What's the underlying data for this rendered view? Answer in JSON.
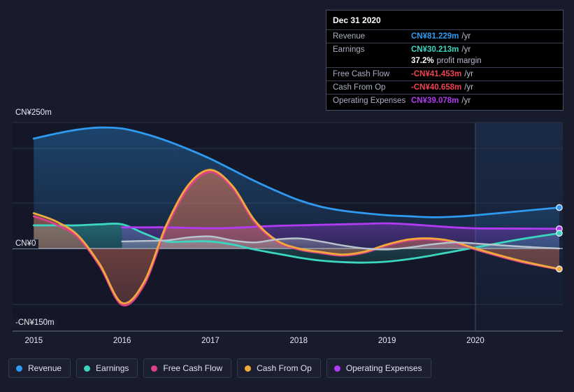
{
  "tooltip": {
    "date": "Dec 31 2020",
    "rows": [
      {
        "label": "Revenue",
        "value": "CN¥81.229m",
        "unit": "/yr",
        "color": "#2e9bf0"
      },
      {
        "label": "Earnings",
        "value": "CN¥30.213m",
        "unit": "/yr",
        "color": "#3ad6bf"
      },
      {
        "label": "",
        "value": "37.2%",
        "unit": "profit margin",
        "color": "#ffffff",
        "sub": true
      },
      {
        "label": "Free Cash Flow",
        "value": "-CN¥41.453m",
        "unit": "/yr",
        "color": "#ef4352"
      },
      {
        "label": "Cash From Op",
        "value": "-CN¥40.658m",
        "unit": "/yr",
        "color": "#ef4352"
      },
      {
        "label": "Operating Expenses",
        "value": "CN¥39.078m",
        "unit": "/yr",
        "color": "#b13bf2"
      }
    ]
  },
  "axis": {
    "y_top_label": "CN¥250m",
    "y_zero_label": "CN¥0",
    "y_bottom_label": "-CN¥150m",
    "x_labels": [
      "2015",
      "2016",
      "2017",
      "2018",
      "2019",
      "2020"
    ]
  },
  "legend": [
    {
      "label": "Revenue",
      "color": "#2e9bf0"
    },
    {
      "label": "Earnings",
      "color": "#3ad6bf"
    },
    {
      "label": "Free Cash Flow",
      "color": "#e0408a"
    },
    {
      "label": "Cash From Op",
      "color": "#f2a93b"
    },
    {
      "label": "Operating Expenses",
      "color": "#b13bf2"
    }
  ],
  "chart_data": {
    "type": "area",
    "title": "",
    "xlabel": "",
    "ylabel": "CN¥",
    "ylim": [
      -150,
      250
    ],
    "yticks": [
      250,
      0,
      -150
    ],
    "ytick_labels": [
      "CN¥250m",
      "CN¥0",
      "-CN¥150m"
    ],
    "xlim": [
      2014.76,
      2020.99
    ],
    "xticks": [
      2015,
      2016,
      2017,
      2018,
      2019,
      2020
    ],
    "grid": true,
    "legend_position": "bottom",
    "forecast_region_start": 2020.0,
    "units": "CN¥ millions per year",
    "series": [
      {
        "name": "Revenue",
        "color": "#2e9bf0",
        "x": [
          2015.0,
          2015.25,
          2015.5,
          2015.75,
          2016.0,
          2016.25,
          2016.5,
          2016.75,
          2017.0,
          2017.25,
          2017.5,
          2017.75,
          2018.0,
          2018.25,
          2018.5,
          2018.75,
          2019.0,
          2019.25,
          2019.5,
          2019.75,
          2020.0,
          2020.5,
          2020.95
        ],
        "values": [
          218,
          228,
          236,
          240,
          238,
          228,
          214,
          197,
          178,
          156,
          134,
          114,
          96,
          83,
          75,
          70,
          66,
          64,
          62,
          63,
          66,
          74,
          81.229
        ]
      },
      {
        "name": "Earnings",
        "color": "#3ad6bf",
        "x": [
          2015.0,
          2015.25,
          2015.5,
          2015.75,
          2016.0,
          2016.25,
          2016.5,
          2016.75,
          2017.0,
          2017.25,
          2017.5,
          2017.75,
          2018.0,
          2018.25,
          2018.5,
          2018.75,
          2019.0,
          2019.25,
          2019.5,
          2019.75,
          2020.0,
          2020.5,
          2020.95
        ],
        "values": [
          46,
          46,
          46,
          48,
          48,
          30,
          14,
          14,
          14,
          8,
          -2,
          -10,
          -18,
          -24,
          -27,
          -28,
          -26,
          -21,
          -14,
          -6,
          2,
          18,
          30.213
        ]
      },
      {
        "name": "Free Cash Flow",
        "color": "#e0408a",
        "x": [
          2015.0,
          2015.25,
          2015.5,
          2015.75,
          2016.0,
          2016.25,
          2016.5,
          2016.75,
          2017.0,
          2017.25,
          2017.5,
          2017.75,
          2018.0,
          2018.25,
          2018.5,
          2018.75,
          2019.0,
          2019.25,
          2019.5,
          2019.75,
          2020.0,
          2020.5,
          2020.95
        ],
        "values": [
          64,
          48,
          22,
          -36,
          -112,
          -72,
          40,
          120,
          152,
          120,
          52,
          14,
          -2,
          -9,
          -14,
          -8,
          6,
          16,
          18,
          12,
          -2,
          -26,
          -41.453
        ]
      },
      {
        "name": "Cash From Op",
        "color": "#f2a93b",
        "x": [
          2015.0,
          2015.25,
          2015.5,
          2015.75,
          2016.0,
          2016.25,
          2016.5,
          2016.75,
          2017.0,
          2017.25,
          2017.5,
          2017.75,
          2018.0,
          2018.25,
          2018.5,
          2018.75,
          2019.0,
          2019.25,
          2019.5,
          2019.75,
          2020.0,
          2020.5,
          2020.95
        ],
        "values": [
          70,
          54,
          26,
          -32,
          -108,
          -66,
          46,
          126,
          156,
          124,
          56,
          16,
          0,
          -7,
          -12,
          -6,
          8,
          18,
          20,
          14,
          0,
          -24,
          -40.658
        ]
      },
      {
        "name": "Operating Expenses",
        "color": "#b13bf2",
        "x": [
          2016.0,
          2016.25,
          2016.5,
          2016.75,
          2017.0,
          2017.25,
          2017.5,
          2017.75,
          2018.0,
          2018.25,
          2018.5,
          2018.75,
          2019.0,
          2019.25,
          2019.5,
          2019.75,
          2020.0,
          2020.5,
          2020.95
        ],
        "values": [
          42,
          42,
          42,
          41,
          40,
          41,
          43,
          45,
          46,
          47,
          48,
          49,
          50,
          48,
          45,
          42,
          40,
          39.5,
          39.078
        ]
      },
      {
        "name": "Operating Expenses Secondary",
        "color": "#b9c4cf",
        "x": [
          2016.0,
          2016.25,
          2016.5,
          2016.75,
          2017.0,
          2017.25,
          2017.5,
          2017.75,
          2018.0,
          2018.25,
          2018.5,
          2018.75,
          2019.0,
          2019.25,
          2019.5,
          2019.75,
          2020.0,
          2020.5,
          2020.95
        ],
        "values": [
          14,
          15,
          16,
          22,
          24,
          16,
          12,
          18,
          20,
          14,
          6,
          0,
          -2,
          2,
          8,
          12,
          10,
          4,
          0
        ]
      }
    ]
  }
}
